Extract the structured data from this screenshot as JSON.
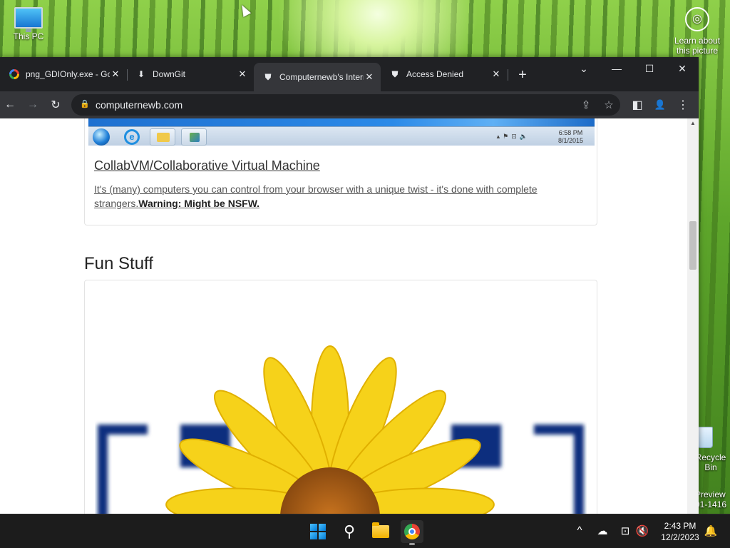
{
  "desktop": {
    "icons": [
      {
        "label": "This PC"
      },
      {
        "label": "Learn about this picture"
      },
      {
        "label": "Recycle Bin"
      }
    ],
    "watermark_line1": "Preview",
    "watermark_line2": "01-1416"
  },
  "browser": {
    "tabs": [
      {
        "title": "png_GDIOnly.exe - Google",
        "favicon": "google-icon",
        "active": false
      },
      {
        "title": "DownGit",
        "favicon": "download-icon",
        "active": false
      },
      {
        "title": "Computernewb's Internet",
        "favicon": "computernewb-icon",
        "active": true
      },
      {
        "title": "Access Denied",
        "favicon": "computernewb-icon",
        "active": false
      }
    ],
    "new_tab_label": "+",
    "window_controls": {
      "tab_search": "⌄",
      "minimize": "—",
      "maximize": "☐",
      "close": "✕"
    },
    "toolbar": {
      "back": "←",
      "forward": "→",
      "reload": "↻"
    },
    "address_bar": {
      "url": "computernewb.com"
    },
    "toolbar_right": {
      "share": "⇪",
      "bookmark": "☆",
      "side_panel": "◧",
      "profile": "👤",
      "menu": "⋮"
    }
  },
  "page": {
    "embedded_screenshot": {
      "clock_time": "6:58 PM",
      "clock_date": "8/1/2015"
    },
    "card1": {
      "title": "CollabVM/Collaborative Virtual Machine",
      "description": "It's (many) computers you can control from your browser with a unique twist - it's done with complete strangers.",
      "warning": "Warning: Might be NSFW."
    },
    "section_heading": "Fun Stuff"
  },
  "taskbar": {
    "pinned": [
      {
        "name": "start-button"
      },
      {
        "name": "search-button"
      },
      {
        "name": "file-explorer"
      },
      {
        "name": "chrome"
      }
    ],
    "tray": {
      "overflow": "^",
      "onedrive": "☁",
      "network": "⊡",
      "volume": "🔇"
    },
    "clock_time": "2:43 PM",
    "clock_date": "12/2/2023",
    "notifications": "🔔"
  }
}
